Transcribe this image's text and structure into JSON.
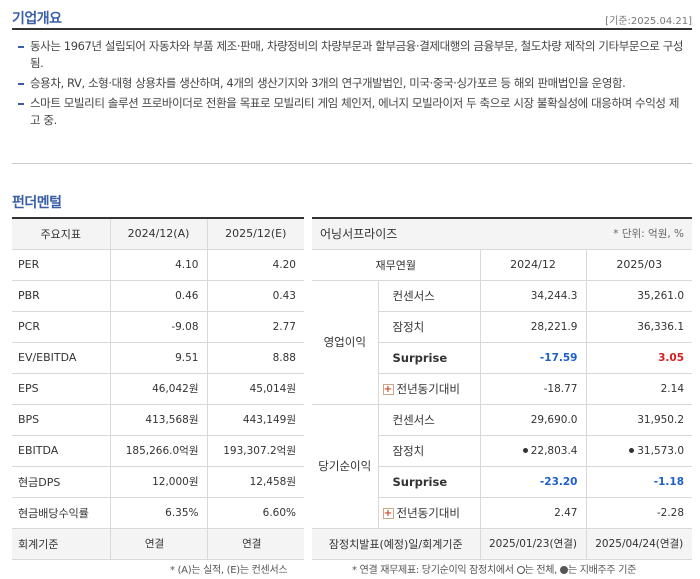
{
  "overview": {
    "title": "기업개요",
    "date": "[기준:2025.04.21]",
    "items": [
      "동사는 1967년 설립되어 자동차와 부품 제조·판매, 차량정비의 차량부문과 할부금융·결제대행의 금융부문, 철도차량 제작의 기타부문으로 구성됨.",
      "승용차, RV, 소형·대형 상용차를 생산하며, 4개의 생산기지와 3개의 연구개발법인, 미국·중국·싱가포르 등 해외 판매법인을 운영함.",
      "스마트 모빌리티 솔루션 프로바이더로 전환을 목표로 모빌리티 게임 체인저, 에너지 모빌라이저 두 축으로 시장 불확실성에 대응하며 수익성 제고 중."
    ]
  },
  "fundamental": {
    "title": "펀더멘털",
    "headers": [
      "주요지표",
      "2024/12(A)",
      "2025/12(E)"
    ],
    "rows": [
      {
        "label": "PER",
        "a": "4.10",
        "e": "4.20"
      },
      {
        "label": "PBR",
        "a": "0.46",
        "e": "0.43"
      },
      {
        "label": "PCR",
        "a": "-9.08",
        "e": "2.77"
      },
      {
        "label": "EV/EBITDA",
        "a": "9.51",
        "e": "8.88"
      },
      {
        "label": "EPS",
        "a": "46,042원",
        "e": "45,014원"
      },
      {
        "label": "BPS",
        "a": "413,568원",
        "e": "443,149원"
      },
      {
        "label": "EBITDA",
        "a": "185,266.0억원",
        "e": "193,307.2억원"
      },
      {
        "label": "현금DPS",
        "a": "12,000원",
        "e": "12,458원"
      },
      {
        "label": "현금배당수익률",
        "a": "6.35%",
        "e": "6.60%"
      },
      {
        "label": "회계기준",
        "a": "연결",
        "e": "연결"
      }
    ],
    "footnote": "* (A)는 실적, (E)는 컨센서스"
  },
  "earnings": {
    "title": "어닝서프라이즈",
    "unit": "* 단위: 억원, %",
    "header_label": "재무연월",
    "header_cols": [
      "2024/12",
      "2025/03"
    ],
    "groups": [
      {
        "name": "영업이익",
        "rows": [
          {
            "label": "컨센서스",
            "v1": "34,244.3",
            "v2": "35,261.0"
          },
          {
            "label": "잠정치",
            "v1": "28,221.9",
            "v2": "36,336.1"
          },
          {
            "label": "Surprise",
            "v1": "-17.59",
            "v2": "3.05"
          },
          {
            "label": "전년동기대비",
            "v1": "-18.77",
            "v2": "2.14"
          }
        ]
      },
      {
        "name": "당기순이익",
        "rows": [
          {
            "label": "컨센서스",
            "v1": "29,690.0",
            "v2": "31,950.2"
          },
          {
            "label": "잠정치",
            "v1": "22,803.4",
            "v2": "31,573.0"
          },
          {
            "label": "Surprise",
            "v1": "-23.20",
            "v2": "-1.18"
          },
          {
            "label": "전년동기대비",
            "v1": "2.47",
            "v2": "-2.28"
          }
        ]
      }
    ],
    "release_label": "잠정치발표(예정)일/회계기준",
    "release_v1": "2025/01/23(연결)",
    "release_v2": "2025/04/24(연결)",
    "foot_a": "* 연결 재무제표: 당기순이익 잠정치에서",
    "foot_b": "는 전체,",
    "foot_c": "는 지배주주 기준",
    "colors": {
      "negative": "#1f5fc8",
      "positive": "#d42020",
      "accent": "#3a5fa8"
    }
  }
}
